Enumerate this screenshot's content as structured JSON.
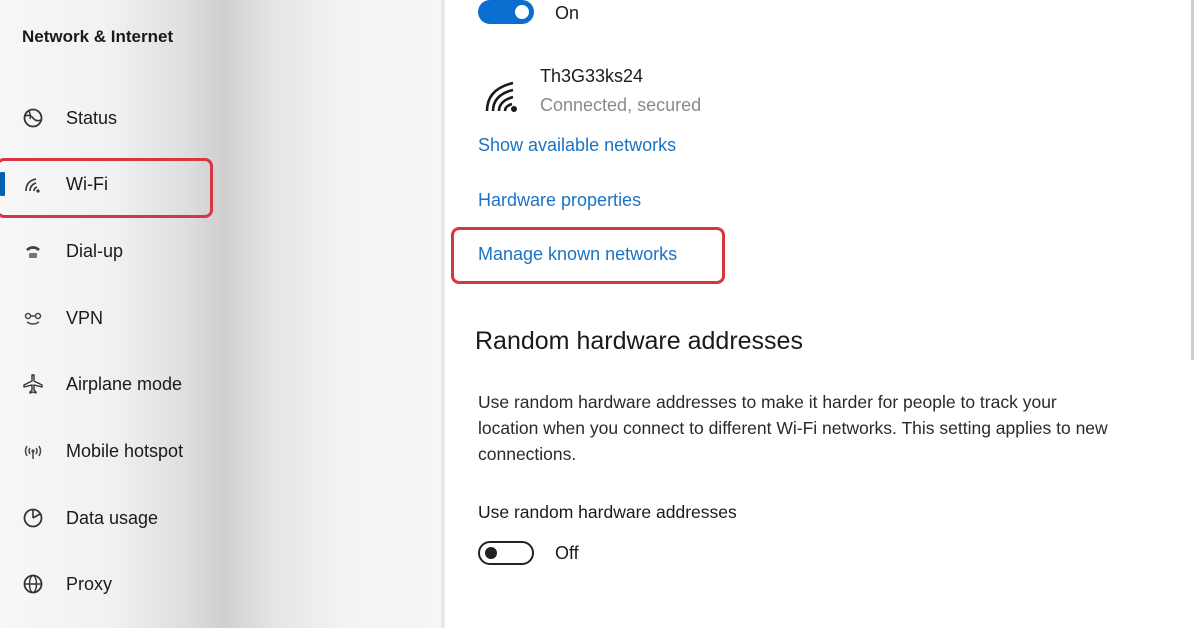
{
  "sidebar": {
    "title": "Network & Internet",
    "items": [
      {
        "label": "Status",
        "icon": "globe-icon"
      },
      {
        "label": "Wi-Fi",
        "icon": "wifi-icon",
        "selected": true
      },
      {
        "label": "Dial-up",
        "icon": "phone-icon"
      },
      {
        "label": "VPN",
        "icon": "vpn-icon"
      },
      {
        "label": "Airplane mode",
        "icon": "airplane-icon"
      },
      {
        "label": "Mobile hotspot",
        "icon": "hotspot-icon"
      },
      {
        "label": "Data usage",
        "icon": "data-usage-icon"
      },
      {
        "label": "Proxy",
        "icon": "globe-icon"
      }
    ]
  },
  "wifi": {
    "toggle_state": "On",
    "toggle_on": true,
    "network": {
      "name": "Th3G33ks24",
      "status": "Connected, secured",
      "icon": "wifi-signal-icon"
    },
    "links": {
      "show_available": "Show available networks",
      "hardware_properties": "Hardware properties",
      "manage_known": "Manage known networks"
    }
  },
  "random_hw": {
    "title": "Random hardware addresses",
    "description": "Use random hardware addresses to make it harder for people to track your location when you connect to different Wi-Fi networks. This setting applies to new connections.",
    "setting_label": "Use random hardware addresses",
    "toggle_state": "Off",
    "toggle_on": false
  },
  "colors": {
    "accent": "#0063b1",
    "link": "#1a73c6",
    "highlight": "#d8363f"
  }
}
